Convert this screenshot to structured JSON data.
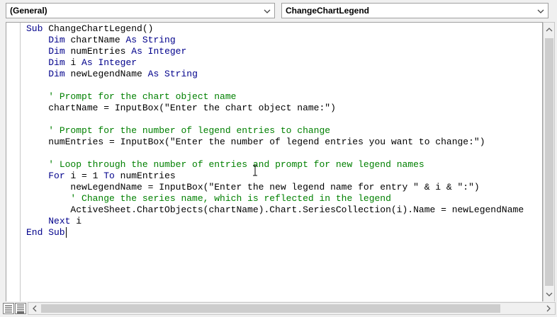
{
  "toolbar": {
    "object_dropdown": "(General)",
    "procedure_dropdown": "ChangeChartLegend"
  },
  "code": {
    "lines": [
      [
        {
          "t": "Sub ",
          "c": "kw"
        },
        {
          "t": "ChangeChartLegend()",
          "c": ""
        }
      ],
      [
        {
          "t": "    ",
          "c": ""
        },
        {
          "t": "Dim ",
          "c": "kw"
        },
        {
          "t": "chartName ",
          "c": ""
        },
        {
          "t": "As String",
          "c": "kw"
        }
      ],
      [
        {
          "t": "    ",
          "c": ""
        },
        {
          "t": "Dim ",
          "c": "kw"
        },
        {
          "t": "numEntries ",
          "c": ""
        },
        {
          "t": "As Integer",
          "c": "kw"
        }
      ],
      [
        {
          "t": "    ",
          "c": ""
        },
        {
          "t": "Dim ",
          "c": "kw"
        },
        {
          "t": "i ",
          "c": ""
        },
        {
          "t": "As Integer",
          "c": "kw"
        }
      ],
      [
        {
          "t": "    ",
          "c": ""
        },
        {
          "t": "Dim ",
          "c": "kw"
        },
        {
          "t": "newLegendName ",
          "c": ""
        },
        {
          "t": "As String",
          "c": "kw"
        }
      ],
      [],
      [
        {
          "t": "    ",
          "c": ""
        },
        {
          "t": "' Prompt for the chart object name",
          "c": "cm"
        }
      ],
      [
        {
          "t": "    chartName = InputBox(\"Enter the chart object name:\")",
          "c": ""
        }
      ],
      [],
      [
        {
          "t": "    ",
          "c": ""
        },
        {
          "t": "' Prompt for the number of legend entries to change",
          "c": "cm"
        }
      ],
      [
        {
          "t": "    numEntries = InputBox(\"Enter the number of legend entries you want to change:\")",
          "c": ""
        }
      ],
      [],
      [
        {
          "t": "    ",
          "c": ""
        },
        {
          "t": "' Loop through the number of entries and prompt for new legend names",
          "c": "cm"
        }
      ],
      [
        {
          "t": "    ",
          "c": ""
        },
        {
          "t": "For ",
          "c": "kw"
        },
        {
          "t": "i = 1 ",
          "c": ""
        },
        {
          "t": "To ",
          "c": "kw"
        },
        {
          "t": "numEntries",
          "c": ""
        }
      ],
      [
        {
          "t": "        newLegendName = InputBox(\"Enter the new legend name for entry \" & i & \":\")",
          "c": ""
        }
      ],
      [
        {
          "t": "        ",
          "c": ""
        },
        {
          "t": "' Change the series name, which is reflected in the legend",
          "c": "cm"
        }
      ],
      [
        {
          "t": "        ActiveSheet.ChartObjects(chartName).Chart.SeriesCollection(i).Name = newLegendName",
          "c": ""
        }
      ],
      [
        {
          "t": "    ",
          "c": ""
        },
        {
          "t": "Next ",
          "c": "kw"
        },
        {
          "t": "i",
          "c": ""
        }
      ],
      [
        {
          "t": "End Sub",
          "c": "kw"
        }
      ]
    ]
  },
  "colors": {
    "keyword": "#00008b",
    "comment": "#008000",
    "text": "#000000"
  },
  "icons": {
    "dropdown_arrow": "chevron-down-icon",
    "procedure_view": "procedure-view-icon",
    "full_module_view": "full-module-view-icon"
  }
}
